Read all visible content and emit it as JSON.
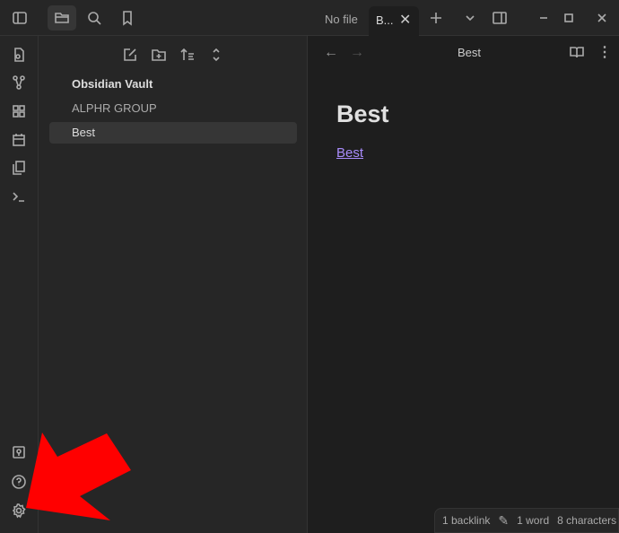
{
  "titlebar": {
    "tab_nofile": "No file",
    "tab_active": "B...",
    "icons": [
      "sidebar-toggle-icon",
      "folder-icon",
      "search-icon",
      "bookmark-icon",
      "plus-icon",
      "chevron-down-icon",
      "split-icon",
      "minimize-icon",
      "maximize-icon",
      "close-icon"
    ]
  },
  "sidebar": {
    "vault_name": "Obsidian Vault",
    "items": [
      {
        "label": "ALPHR GROUP"
      },
      {
        "label": "Best"
      }
    ]
  },
  "editor": {
    "header_title": "Best",
    "heading": "Best",
    "link": "Best"
  },
  "status": {
    "backlinks": "1 backlink",
    "words": "1 word",
    "chars": "8 characters"
  },
  "colors": {
    "accent": "#a88bfa",
    "arrow": "#ff0000"
  }
}
